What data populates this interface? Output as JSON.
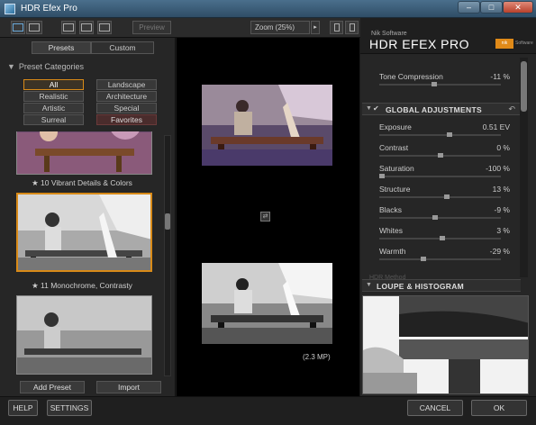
{
  "window": {
    "title": "HDR Efex Pro",
    "min_glyph": "–",
    "max_glyph": "□",
    "close_glyph": "✕"
  },
  "toolbar": {
    "preview_label": "Preview",
    "zoom_label": "Zoom (25%)",
    "zoom_arrow": "▸"
  },
  "left": {
    "tabs": {
      "presets": "Presets",
      "custom": "Custom"
    },
    "categories_header": "Preset Categories",
    "categories": [
      {
        "label": "All",
        "active": true
      },
      {
        "label": "Landscape",
        "active": false
      },
      {
        "label": "Realistic",
        "active": false
      },
      {
        "label": "Architecture",
        "active": false
      },
      {
        "label": "Artistic",
        "active": false
      },
      {
        "label": "Special",
        "active": false
      },
      {
        "label": "Surreal",
        "active": false
      },
      {
        "label": "Favorites",
        "active": false
      }
    ],
    "presets": [
      {
        "caption": "★ 10 Vibrant Details & Colors"
      },
      {
        "caption": "★ 11 Monochrome, Contrasty"
      }
    ],
    "add_preset": "Add Preset",
    "import": "Import"
  },
  "center": {
    "megapixels": "(2.3 MP)",
    "sync_glyph": "⇄"
  },
  "right": {
    "brand_small": "Nik Software",
    "brand_name": "HDR EFEX PRO",
    "logo_text": "nik",
    "logo_small": "Software",
    "tone_compression": {
      "label": "Tone Compression",
      "value": "-11 %",
      "level": 0.45
    },
    "global_title": "GLOBAL ADJUSTMENTS",
    "check_glyph": "✔",
    "reset_glyph": "↶",
    "global": [
      {
        "label": "Exposure",
        "value": "0.51 EV",
        "level": 0.58
      },
      {
        "label": "Contrast",
        "value": "0 %",
        "level": 0.5
      },
      {
        "label": "Saturation",
        "value": "-100 %",
        "level": 0.0
      },
      {
        "label": "Structure",
        "value": "13 %",
        "level": 0.56
      },
      {
        "label": "Blacks",
        "value": "-9 %",
        "level": 0.46
      },
      {
        "label": "Whites",
        "value": "3 %",
        "level": 0.52
      },
      {
        "label": "Warmth",
        "value": "-29 %",
        "level": 0.36
      }
    ],
    "hidden_section": "HDR Method",
    "loupe_title": "LOUPE & HISTOGRAM"
  },
  "bottom": {
    "help": "HELP",
    "settings": "SETTINGS",
    "cancel": "CANCEL",
    "ok": "OK"
  },
  "colors": {
    "accent": "#d88a18",
    "panel": "#262626",
    "preview_bg": "#000000"
  }
}
